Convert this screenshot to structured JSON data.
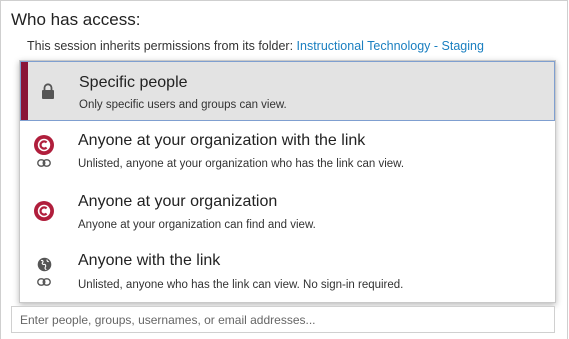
{
  "access": {
    "heading": "Who has access:",
    "inherit_text": "This session inherits permissions from its folder: ",
    "folder_link": "Instructional Technology - Staging"
  },
  "options": [
    {
      "title": "Specific people",
      "description": "Only specific users and groups can view.",
      "icon": "lock-icon",
      "selected": true
    },
    {
      "title": "Anyone at your organization with the link",
      "description": "Unlisted, anyone at your organization who has the link can view.",
      "icon": "organization-logo-icon",
      "secondary_icon": "link-icon",
      "selected": false
    },
    {
      "title": "Anyone at your organization",
      "description": "Anyone at your organization can find and view.",
      "icon": "organization-logo-icon",
      "selected": false
    },
    {
      "title": "Anyone with the link",
      "description": "Unlisted, anyone who has the link can view. No sign-in required.",
      "icon": "globe-icon",
      "secondary_icon": "link-icon",
      "selected": false
    }
  ],
  "people_input": {
    "placeholder": "Enter people, groups, usernames, or email addresses...",
    "value": ""
  },
  "colors": {
    "selected_bar": "#8a1538",
    "selected_background": "#e3e3e3",
    "link": "#1a7fc0",
    "org_logo": "#b01e3c"
  }
}
